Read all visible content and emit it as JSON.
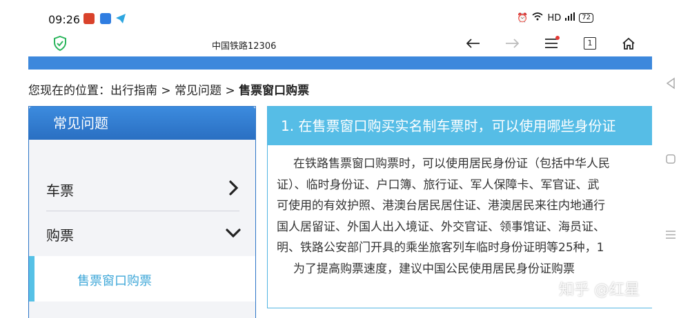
{
  "status_bar": {
    "time": "09:26",
    "network": "HD",
    "battery": "72"
  },
  "browser": {
    "page_title": "中国铁路12306",
    "back_icon": "arrow-left-icon",
    "forward_icon": "arrow-right-icon",
    "menu_icon": "menu-icon",
    "tabs_count": "1",
    "home_icon": "home-icon"
  },
  "breadcrumb": {
    "prefix": "您现在的位置：",
    "items": [
      "出行指南",
      "常见问题"
    ],
    "separator": " > ",
    "current": "售票窗口购票"
  },
  "sidebar": {
    "title": "常见问题",
    "items": [
      {
        "label": "车票",
        "state": "collapsed"
      },
      {
        "label": "购票",
        "state": "expanded"
      }
    ],
    "sub_items": [
      {
        "label": "售票窗口购票",
        "active": true
      }
    ]
  },
  "content": {
    "question": "1. 在售票窗口购买实名制车票时，可以使用哪些身份证",
    "paragraph_lines": [
      "在铁路售票窗口购票时，可以使用居民身份证（包括中华人民",
      "证）、临时身份证、户口簿、旅行证、军人保障卡、军官证、武",
      "可使用的有效护照、港澳台居民居住证、港澳居民来往内地通行",
      "国人居留证、外国人出入境证、外交官证、领事馆证、海员证、",
      "明、铁路公安部门开具的乘坐旅客列车临时身份证明等25种，1",
      "为了提高购票速度，建议中国公民使用居民身份证购票"
    ]
  },
  "watermark": "知乎 @红星",
  "colors": {
    "brand_blue": "#3d88dc",
    "panel_blue": "#56bde6",
    "active_text": "#3ea7d8"
  }
}
